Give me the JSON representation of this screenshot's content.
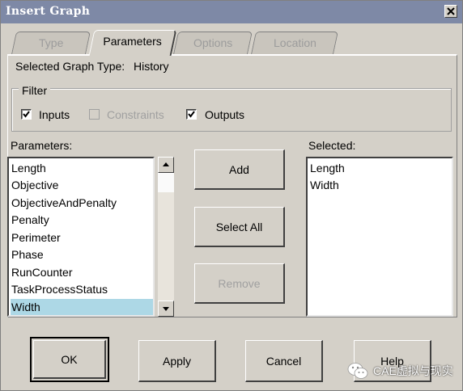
{
  "window": {
    "title": "Insert Graph"
  },
  "tabs": [
    {
      "label": "Type",
      "active": false
    },
    {
      "label": "Parameters",
      "active": true
    },
    {
      "label": "Options",
      "active": false
    },
    {
      "label": "Location",
      "active": false
    }
  ],
  "graph_type": {
    "label": "Selected Graph Type:",
    "value": "History"
  },
  "filter": {
    "legend": "Filter",
    "options": [
      {
        "label": "Inputs",
        "checked": true,
        "enabled": true
      },
      {
        "label": "Constraints",
        "checked": false,
        "enabled": false
      },
      {
        "label": "Outputs",
        "checked": true,
        "enabled": true
      }
    ]
  },
  "parameters": {
    "label": "Parameters:",
    "items": [
      "Length",
      "Objective",
      "ObjectiveAndPenalty",
      "Penalty",
      "Perimeter",
      "Phase",
      "RunCounter",
      "TaskProcessStatus",
      "Width"
    ],
    "selected_item": "Width"
  },
  "actions": {
    "add": "Add",
    "select_all": "Select All",
    "remove": "Remove"
  },
  "selected": {
    "label": "Selected:",
    "items": [
      "Length",
      "Width"
    ]
  },
  "footer": {
    "ok": "OK",
    "apply": "Apply",
    "cancel": "Cancel",
    "help": "Help"
  },
  "watermark": {
    "text": "CAE虚拟与现实",
    "icon": "wechat-icon"
  },
  "colors": {
    "titlebar": "#7e89a6",
    "dialog": "#d4d0c8",
    "selection": "#add8e6"
  }
}
